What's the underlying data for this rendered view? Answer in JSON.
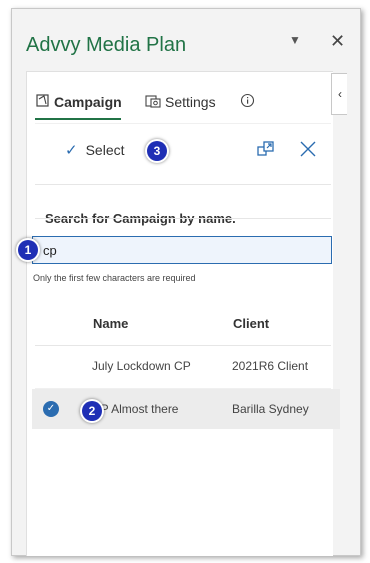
{
  "app": {
    "title": "Advvy Media Plan"
  },
  "tabs": [
    {
      "label": "Campaign",
      "icon": "campaign-icon"
    },
    {
      "label": "Settings",
      "icon": "settings-icon"
    },
    {
      "label": "",
      "icon": "info-icon"
    }
  ],
  "toolbar": {
    "select_label": "Select",
    "badge3": "3"
  },
  "search": {
    "label": "Search for Campaign by name.",
    "value": "cp",
    "hint": "Only the first few characters are required",
    "badge1": "1"
  },
  "table": {
    "headers": [
      "Name",
      "Client"
    ],
    "rows": [
      {
        "name": "July Lockdown CP",
        "client": "2021R6 Client",
        "selected": false
      },
      {
        "name": "CP Almost there",
        "client": "Barilla Sydney",
        "selected": true,
        "badge": "2"
      }
    ]
  },
  "colors": {
    "accent": "#217346",
    "link": "#2b6cb0",
    "badge": "#1f2fb5"
  }
}
